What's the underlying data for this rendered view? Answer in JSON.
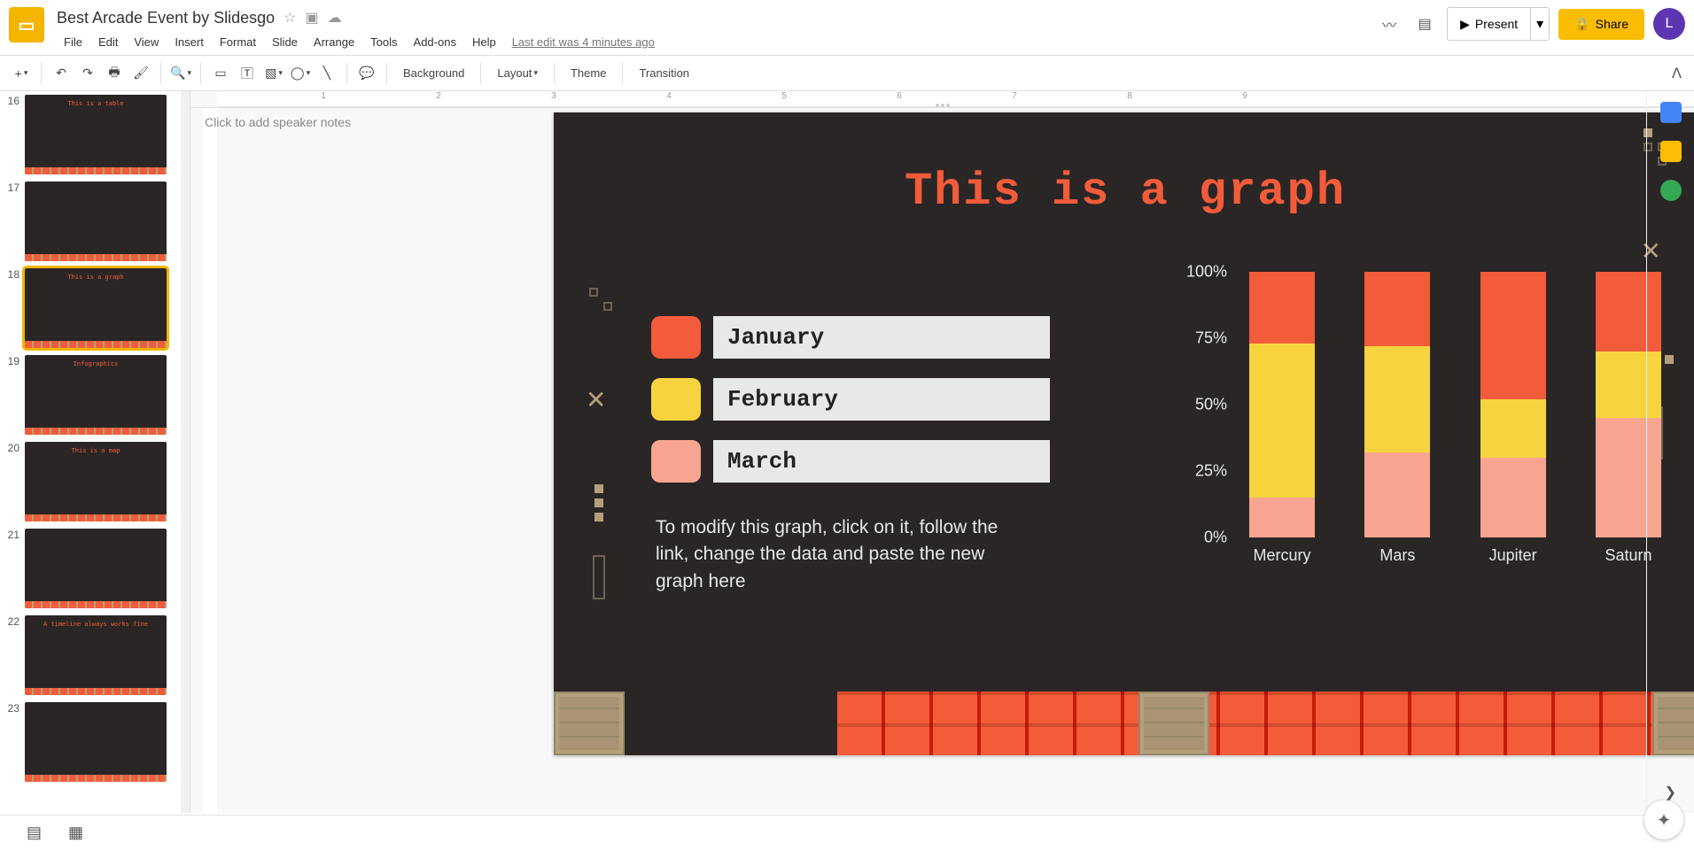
{
  "header": {
    "title": "Best Arcade Event by Slidesgo",
    "last_edit": "Last edit was 4 minutes ago",
    "present": "Present",
    "share": "Share",
    "avatar_letter": "L"
  },
  "menu": [
    "File",
    "Edit",
    "View",
    "Insert",
    "Format",
    "Slide",
    "Arrange",
    "Tools",
    "Add-ons",
    "Help"
  ],
  "toolbar": {
    "background": "Background",
    "layout": "Layout",
    "theme": "Theme",
    "transition": "Transition"
  },
  "ruler_h": [
    "1",
    "2",
    "3",
    "4",
    "5",
    "6",
    "7",
    "8",
    "9"
  ],
  "filmstrip": [
    {
      "num": "16",
      "title": "This is a table"
    },
    {
      "num": "17",
      "title": ""
    },
    {
      "num": "18",
      "title": "This is a graph",
      "selected": true
    },
    {
      "num": "19",
      "title": "Infographics"
    },
    {
      "num": "20",
      "title": "This is a map"
    },
    {
      "num": "21",
      "title": ""
    },
    {
      "num": "22",
      "title": "A timeline always works fine"
    },
    {
      "num": "23",
      "title": ""
    }
  ],
  "slide": {
    "title": "This is a graph",
    "legend": [
      {
        "label": "January",
        "swatch": "swatch-jan"
      },
      {
        "label": "February",
        "swatch": "swatch-feb"
      },
      {
        "label": "March",
        "swatch": "swatch-mar"
      }
    ],
    "note": "To modify this graph, click on it, follow the link, change the data and paste the new graph here",
    "y_ticks": [
      "100%",
      "75%",
      "50%",
      "25%",
      "0%"
    ]
  },
  "chart_data": {
    "type": "bar",
    "stacked": true,
    "unit": "%",
    "title": "This is a graph",
    "ylabel": "",
    "xlabel": "",
    "ylim": [
      0,
      100
    ],
    "categories": [
      "Mercury",
      "Mars",
      "Jupiter",
      "Saturn"
    ],
    "series": [
      {
        "name": "January",
        "color": "#f25c3a",
        "values": [
          27,
          28,
          48,
          30
        ]
      },
      {
        "name": "February",
        "color": "#f7d43f",
        "values": [
          58,
          40,
          22,
          25
        ]
      },
      {
        "name": "March",
        "color": "#f7a590",
        "values": [
          15,
          32,
          30,
          45
        ]
      }
    ]
  },
  "notes_placeholder": "Click to add speaker notes"
}
